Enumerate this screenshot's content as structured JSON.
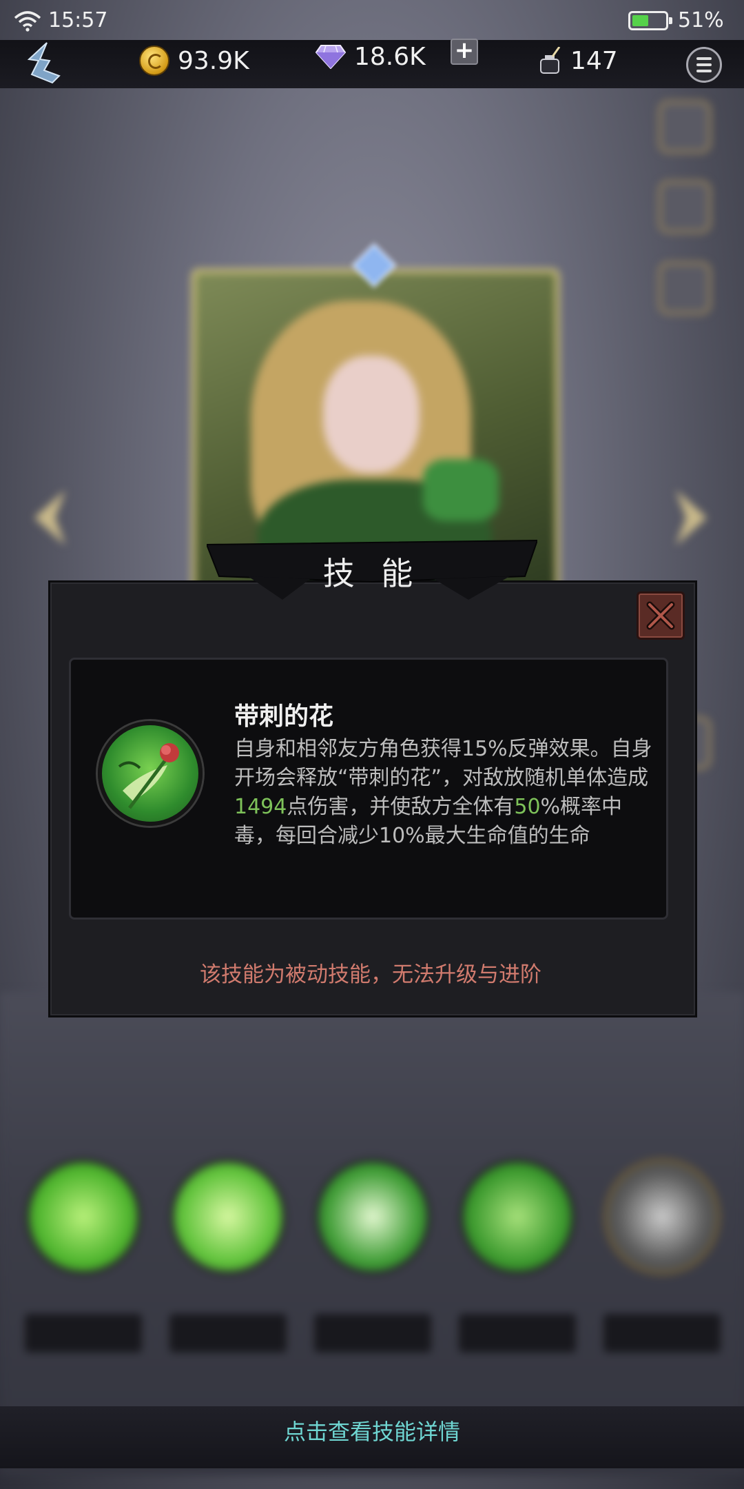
{
  "status_bar": {
    "time": "15:57",
    "battery": "51%",
    "battery_level": 0.51
  },
  "resources": {
    "gold": "93.9K",
    "gems": "18.6K",
    "ink": "147"
  },
  "modal": {
    "title": "技 能",
    "skill_name": "带刺的花",
    "description": [
      {
        "text": "自身和相邻友方角色获得15%反弹效果。自身开场会释放“带刺的花”，对敌放随机单体造成",
        "hl": false
      },
      {
        "text": "1494",
        "hl": true
      },
      {
        "text": "点伤害，并使敌方全体有",
        "hl": false
      },
      {
        "text": "50",
        "hl": true
      },
      {
        "text": "%概率中毒，每回合减少10%最大生命值的生命",
        "hl": false
      }
    ],
    "note": "该技能为被动技能，无法升级与进阶"
  },
  "bottom": {
    "hint": "点击查看技能详情"
  },
  "colors": {
    "accent_green": "#7ec25a",
    "note_red": "#d17b6e",
    "hint_cyan": "#6fd6d2"
  },
  "icons": [
    "wifi-icon",
    "battery-icon",
    "back-icon",
    "coin-icon",
    "gem-icon",
    "plus-icon",
    "ink-icon",
    "menu-icon",
    "close-icon",
    "thorny-flower-icon"
  ]
}
